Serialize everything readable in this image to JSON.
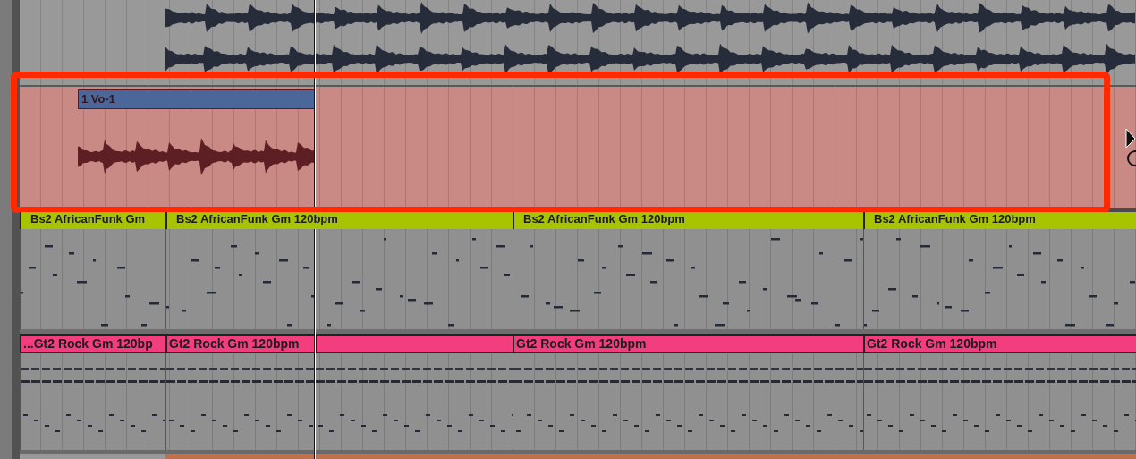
{
  "vocal_track": {
    "clip_name": "1 Vo-1"
  },
  "bass_track": {
    "clips": [
      {
        "kind": "named",
        "name": "Bs2 AfricanFunk Gm"
      },
      {
        "kind": "named",
        "name": "Bs2 AfricanFunk Gm 120bpm"
      },
      {
        "kind": "named",
        "name": "Bs2 AfricanFunk Gm 120bpm"
      },
      {
        "kind": "named",
        "name": "Bs2 AfricanFunk Gm 120bpm"
      }
    ]
  },
  "guitar_track": {
    "clips": [
      {
        "kind": "named",
        "name": "...Gt2 Rock Gm 120bp"
      },
      {
        "kind": "named",
        "name": "Gt2 Rock Gm 120bpm"
      },
      {
        "kind": "blank"
      },
      {
        "kind": "named",
        "name": "Gt2 Rock Gm 120bpm"
      },
      {
        "kind": "named",
        "name": "Gt2 Rock Gm 120bpm"
      }
    ]
  }
}
